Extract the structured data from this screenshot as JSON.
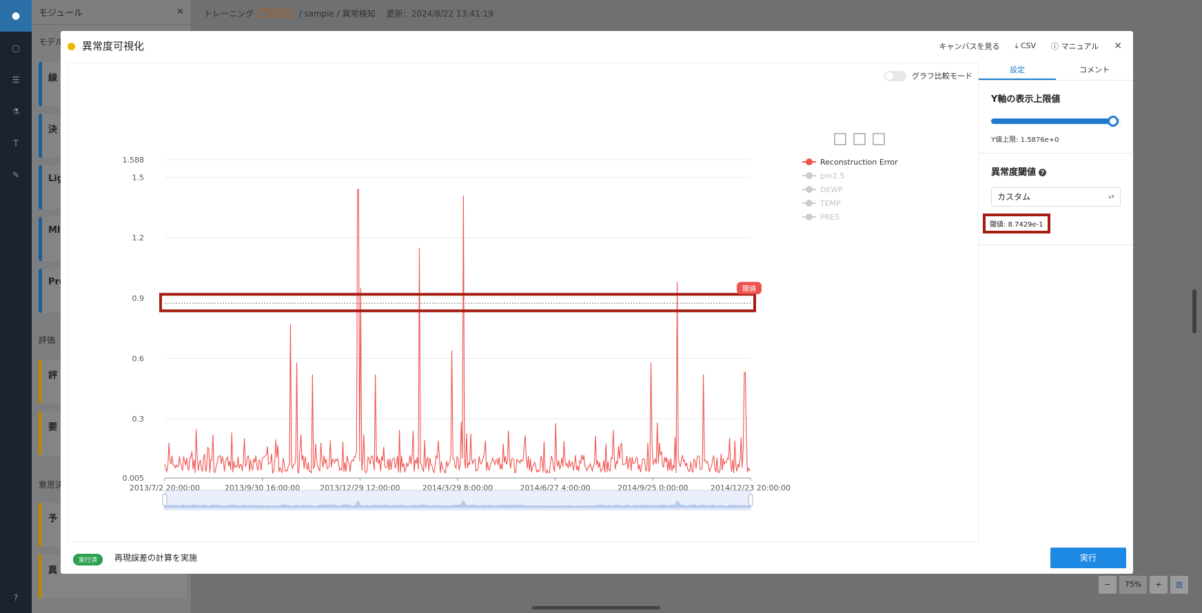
{
  "app": {
    "panel_title": "モジュール",
    "sections": [
      "モデル",
      "評価",
      "意思決"
    ],
    "cards": [
      "線",
      "決",
      "Lig",
      "Ml",
      "Pre",
      "評",
      "要",
      "予",
      "異"
    ]
  },
  "breadcrumb": {
    "root": "トレーニング",
    "tag": "Training",
    "path": "/ sample / 異常検知",
    "updated": "更新：2024/8/22 13:41:19"
  },
  "modal": {
    "title": "異常度可視化",
    "actions": [
      "キャンバスを見る",
      "CSV",
      "マニュアル"
    ]
  },
  "chart_toolbar": {
    "compare_mode": "グラフ比較モード"
  },
  "chart_data": {
    "type": "line",
    "ylim": [
      0.005,
      1.588
    ],
    "ytick_labels": [
      "1.588",
      "1.5",
      "1.2",
      "0.9",
      "0.6",
      "0.3",
      "0.005"
    ],
    "yticks": [
      1.588,
      1.5,
      1.2,
      0.9,
      0.6,
      0.3,
      0.005
    ],
    "xtick_labels": [
      "2013/7/2 20:00:00",
      "2013/9/30 16:00:00",
      "2013/12/29 12:00:00",
      "2014/3/29 8:00:00",
      "2014/6/27 4:00:00",
      "2014/9/25 0:00:00",
      "2014/12/23 20:00:00"
    ],
    "legend": [
      "Reconstruction Error",
      "pm2.5",
      "DEWP",
      "TEMP",
      "PRES"
    ],
    "threshold": {
      "label": "閾値",
      "value": 0.87429
    },
    "peaks": [
      [
        0.215,
        0.77
      ],
      [
        0.225,
        0.58
      ],
      [
        0.252,
        0.52
      ],
      [
        0.33,
        1.44
      ],
      [
        0.335,
        0.95
      ],
      [
        0.36,
        0.52
      ],
      [
        0.435,
        1.15
      ],
      [
        0.49,
        0.64
      ],
      [
        0.51,
        1.41
      ],
      [
        0.83,
        0.58
      ],
      [
        0.875,
        0.98
      ],
      [
        0.92,
        0.52
      ],
      [
        0.99,
        0.53
      ]
    ]
  },
  "settings": {
    "tabs": [
      "設定",
      "コメント"
    ],
    "y_max_title": "Y軸の表示上限値",
    "y_max_value": "Y値上限: 1.5876e+0",
    "y_slider_level": 0.94,
    "anomaly_title": "異常度閾値",
    "mode": "カスタム",
    "threshold_text": "閾値: 8.7429e-1"
  },
  "footer": {
    "status_badge": "実行済",
    "status_text": "再現誤差の計算を実施",
    "run_label": "実行"
  },
  "zoom": {
    "minus": "−",
    "value": "75%",
    "plus": "+"
  },
  "colors": {
    "series": "#ef5350",
    "accent": "#1e7bd0",
    "highlight": "#a51c12",
    "status": "#2ea04f"
  }
}
